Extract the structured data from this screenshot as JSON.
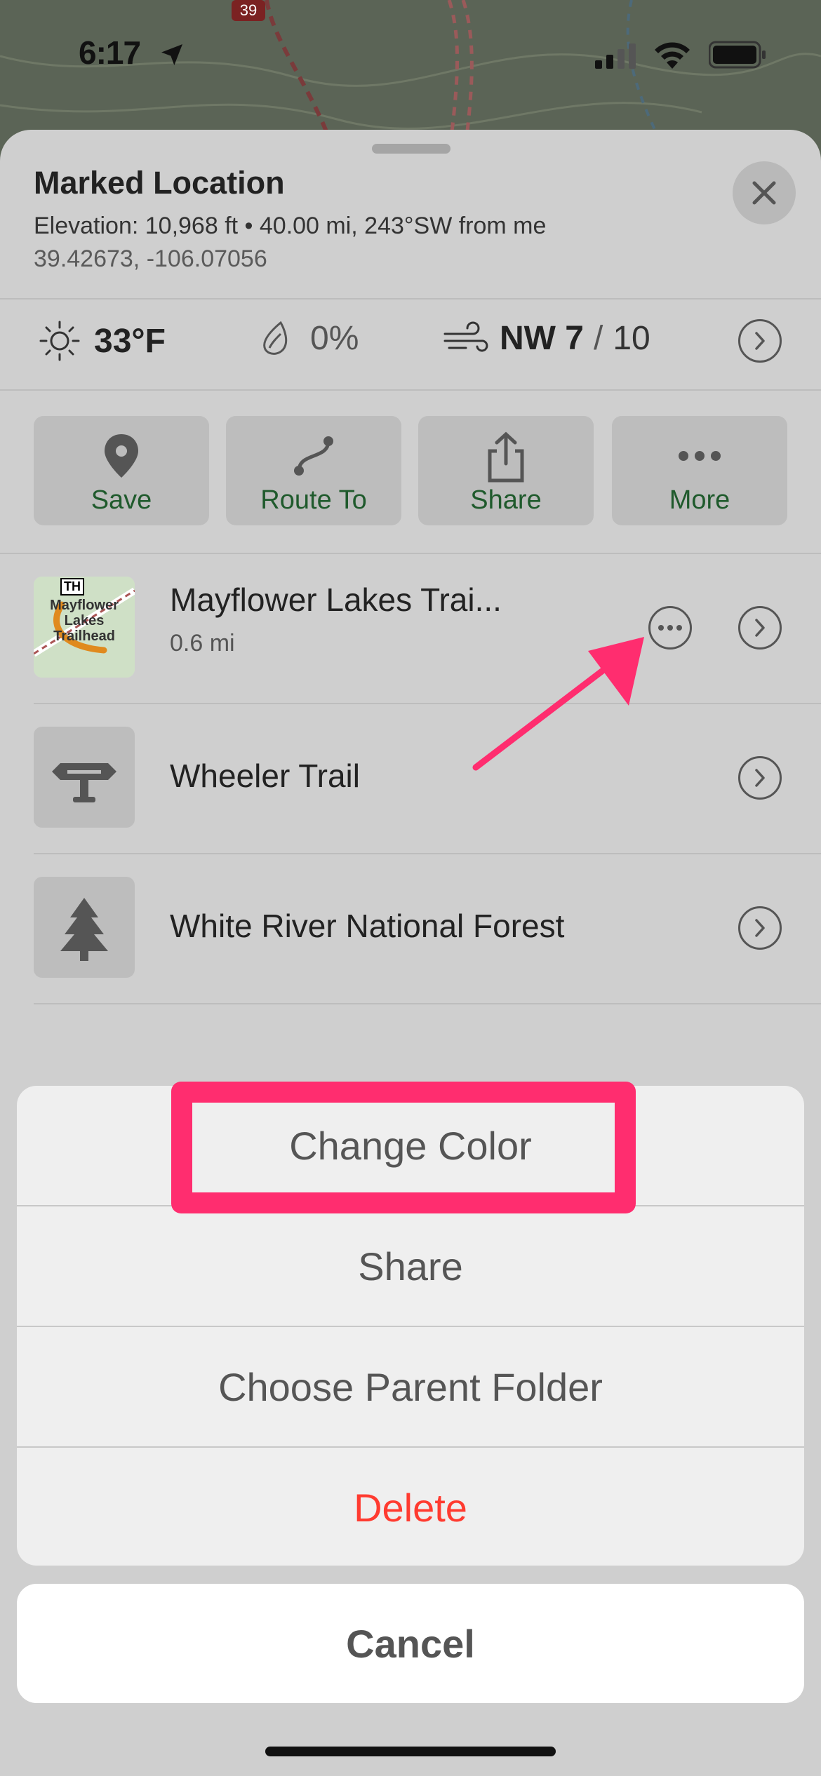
{
  "status_bar": {
    "time": "6:17"
  },
  "map": {
    "route_marker": "39"
  },
  "sheet": {
    "title": "Marked Location",
    "elevation_line": "Elevation: 10,968 ft • 40.00 mi, 243°SW from me",
    "coordinates": "39.42673, -106.07056"
  },
  "weather": {
    "temperature": "33°F",
    "precipitation": "0%",
    "wind_direction_speed": "NW 7",
    "wind_separator": "/",
    "wind_gust": "10"
  },
  "actions": [
    {
      "label": "Save",
      "icon": "map-pin-icon"
    },
    {
      "label": "Route To",
      "icon": "route-icon"
    },
    {
      "label": "Share",
      "icon": "share-icon"
    },
    {
      "label": "More",
      "icon": "more-dots-icon"
    }
  ],
  "nearby": [
    {
      "name": "Mayflower Lakes Trai...",
      "distance": "0.6 mi",
      "thumb_text": [
        "Mayflower",
        "Lakes",
        "Trailhead"
      ],
      "thumb_badge": "TH"
    },
    {
      "name": "Wheeler Trail",
      "icon": "trail-sign-icon"
    },
    {
      "name": "White River National Forest",
      "icon": "tree-icon"
    }
  ],
  "action_sheet": {
    "items": [
      "Change Color",
      "Share",
      "Choose Parent Folder",
      "Delete"
    ],
    "cancel": "Cancel"
  },
  "colors": {
    "accent_green": "#1f5a2c",
    "destructive": "#ff3b30",
    "annotation": "#ff2d6f"
  }
}
